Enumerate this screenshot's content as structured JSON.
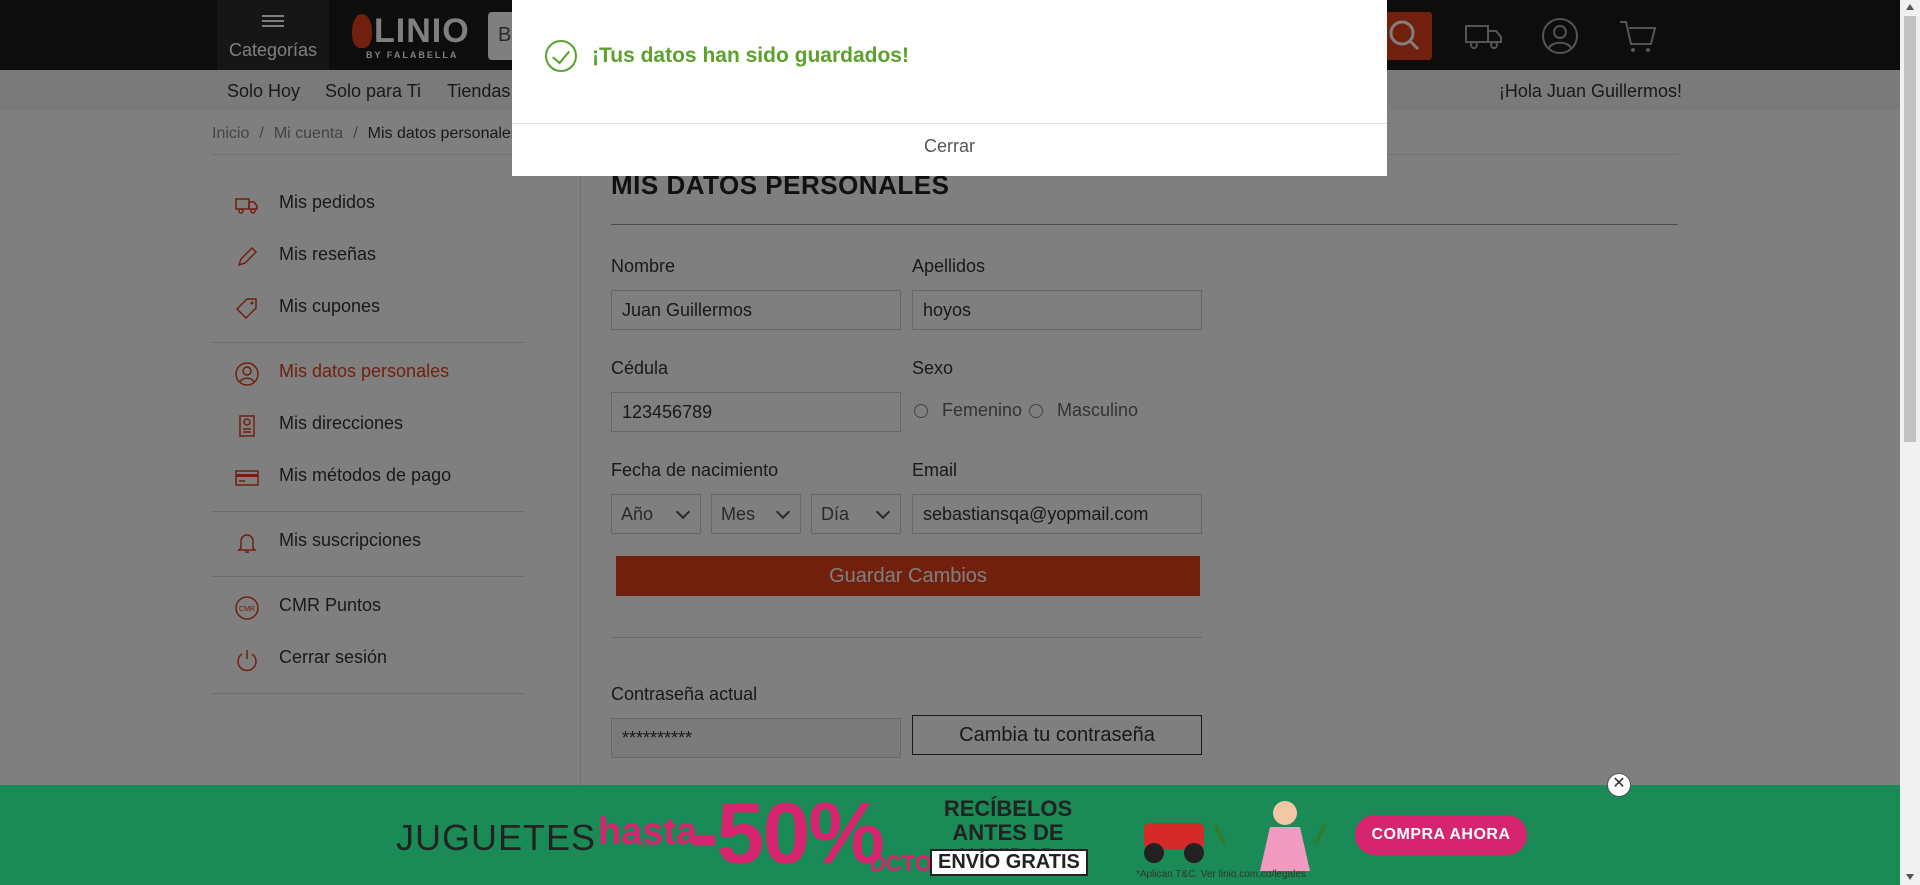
{
  "header": {
    "categories_label": "Categorías",
    "logo_text": "LINIO",
    "logo_sub": "BY FALABELLA",
    "search_placeholder": "B"
  },
  "nav": {
    "items": [
      "Solo Hoy",
      "Solo para Ti",
      "Tiendas"
    ],
    "greeting": "¡Hola Juan Guillermos!"
  },
  "breadcrumb": {
    "items": [
      "Inicio",
      "Mi cuenta",
      "Mis datos personales"
    ]
  },
  "sidebar": {
    "items": [
      {
        "label": "Mis pedidos",
        "icon": "truck-icon"
      },
      {
        "label": "Mis reseñas",
        "icon": "pencil-icon"
      },
      {
        "label": "Mis cupones",
        "icon": "tag-icon"
      },
      {
        "label": "Mis datos personales",
        "icon": "user-icon",
        "active": true
      },
      {
        "label": "Mis direcciones",
        "icon": "address-icon"
      },
      {
        "label": "Mis métodos de pago",
        "icon": "card-icon"
      },
      {
        "label": "Mis suscripciones",
        "icon": "bell-icon"
      },
      {
        "label": "CMR Puntos",
        "icon": "cmr-icon"
      },
      {
        "label": "Cerrar sesión",
        "icon": "power-icon"
      }
    ]
  },
  "form": {
    "title": "MIS DATOS PERSONALES",
    "nombre_label": "Nombre",
    "nombre_value": "Juan Guillermos",
    "apellidos_label": "Apellidos",
    "apellidos_value": "hoyos",
    "cedula_label": "Cédula",
    "cedula_value": "123456789",
    "sexo_label": "Sexo",
    "sexo_options": [
      "Femenino",
      "Masculino"
    ],
    "fecha_label": "Fecha de nacimiento",
    "fecha_selects": [
      "Año",
      "Mes",
      "Día"
    ],
    "email_label": "Email",
    "email_value": "sebastiansqa@yopmail.com",
    "save_label": "Guardar Cambios",
    "password_label": "Contraseña actual",
    "password_value": "**********",
    "change_password_label": "Cambia tu contraseña"
  },
  "modal": {
    "message": "¡Tus datos han sido guardados!",
    "close_label": "Cerrar"
  },
  "banner": {
    "text1": "JUGUETES",
    "text2": "hasta",
    "text3": "-50%",
    "text4": "DCTO.",
    "text5": "RECÍBELOS ANTES DE NAVIDAD",
    "text6": "ENVÍO GRATIS",
    "legal": "*Aplican T&C. Ver linio.com.co/legales",
    "cta": "COMPRA AHORA",
    "close_symbol": "✕"
  },
  "colors": {
    "brand": "#e2401c",
    "success": "#5aa22c",
    "banner_bg": "#1a8a56",
    "banner_accent": "#d6246e"
  }
}
